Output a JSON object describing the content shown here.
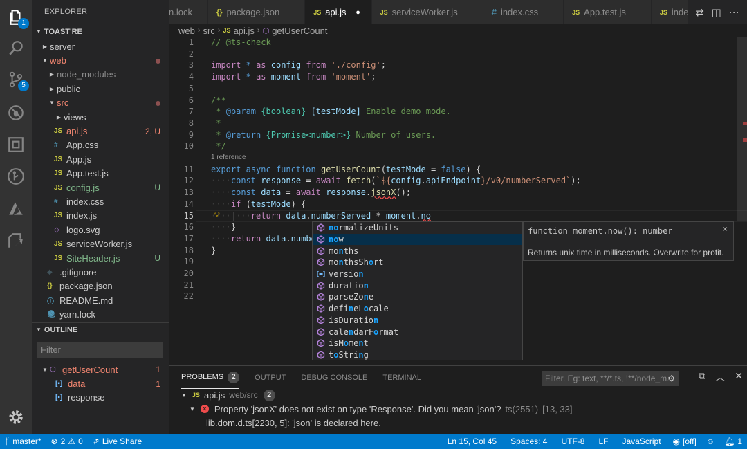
{
  "activity_bar": {
    "items": [
      {
        "name": "explorer",
        "badge": "1"
      },
      {
        "name": "search",
        "badge": null
      },
      {
        "name": "source-control",
        "badge": "5"
      },
      {
        "name": "debug",
        "badge": null
      },
      {
        "name": "extensions",
        "badge": null
      },
      {
        "name": "gitlens",
        "badge": null
      },
      {
        "name": "azure",
        "badge": null
      },
      {
        "name": "live-share",
        "badge": null
      }
    ]
  },
  "sidebar": {
    "title": "EXPLORER",
    "root": "TOAST'RE",
    "tree": [
      {
        "label": "server",
        "depth": 0,
        "type": "folder",
        "expanded": false,
        "color": "default",
        "deco": ""
      },
      {
        "label": "web",
        "depth": 0,
        "type": "folder",
        "expanded": true,
        "color": "red",
        "deco": "dot"
      },
      {
        "label": "node_modules",
        "depth": 1,
        "type": "folder",
        "expanded": false,
        "color": "dim",
        "deco": ""
      },
      {
        "label": "public",
        "depth": 1,
        "type": "folder",
        "expanded": false,
        "color": "default",
        "deco": ""
      },
      {
        "label": "src",
        "depth": 1,
        "type": "folder",
        "expanded": true,
        "color": "red",
        "deco": "dot"
      },
      {
        "label": "views",
        "depth": 2,
        "type": "folder",
        "expanded": false,
        "color": "default",
        "deco": ""
      },
      {
        "label": "api.js",
        "depth": 2,
        "type": "js",
        "color": "red",
        "deco": "2, U"
      },
      {
        "label": "App.css",
        "depth": 2,
        "type": "css",
        "color": "default",
        "deco": ""
      },
      {
        "label": "App.js",
        "depth": 2,
        "type": "js",
        "color": "default",
        "deco": ""
      },
      {
        "label": "App.test.js",
        "depth": 2,
        "type": "js",
        "color": "default",
        "deco": ""
      },
      {
        "label": "config.js",
        "depth": 2,
        "type": "js",
        "color": "green",
        "deco": "U"
      },
      {
        "label": "index.css",
        "depth": 2,
        "type": "css",
        "color": "default",
        "deco": ""
      },
      {
        "label": "index.js",
        "depth": 2,
        "type": "js",
        "color": "default",
        "deco": ""
      },
      {
        "label": "logo.svg",
        "depth": 2,
        "type": "svg",
        "color": "default",
        "deco": ""
      },
      {
        "label": "serviceWorker.js",
        "depth": 2,
        "type": "js",
        "color": "default",
        "deco": ""
      },
      {
        "label": "SiteHeader.js",
        "depth": 2,
        "type": "js",
        "color": "green",
        "deco": "U"
      },
      {
        "label": ".gitignore",
        "depth": 1,
        "type": "git",
        "color": "default",
        "deco": ""
      },
      {
        "label": "package.json",
        "depth": 1,
        "type": "json",
        "color": "default",
        "deco": ""
      },
      {
        "label": "README.md",
        "depth": 1,
        "type": "md",
        "color": "default",
        "deco": ""
      },
      {
        "label": "yarn.lock",
        "depth": 1,
        "type": "yarn",
        "color": "default",
        "deco": ""
      }
    ],
    "outline": {
      "title": "OUTLINE",
      "filter_placeholder": "Filter",
      "items": [
        {
          "label": "getUserCount",
          "depth": 0,
          "kind": "function",
          "color": "red",
          "count": "1"
        },
        {
          "label": "data",
          "depth": 1,
          "kind": "variable",
          "color": "red",
          "count": "1"
        },
        {
          "label": "response",
          "depth": 1,
          "kind": "variable",
          "color": "default",
          "count": ""
        }
      ]
    }
  },
  "tabs": [
    {
      "label": "n.lock",
      "icon": "",
      "active": false,
      "dirty": false
    },
    {
      "label": "package.json",
      "icon": "{}",
      "active": false,
      "dirty": false
    },
    {
      "label": "api.js",
      "icon": "JS",
      "active": true,
      "dirty": true
    },
    {
      "label": "serviceWorker.js",
      "icon": "JS",
      "active": false,
      "dirty": false
    },
    {
      "label": "index.css",
      "icon": "#",
      "active": false,
      "dirty": false
    },
    {
      "label": "App.test.js",
      "icon": "JS",
      "active": false,
      "dirty": false
    },
    {
      "label": "index.js",
      "icon": "JS",
      "active": false,
      "dirty": false
    }
  ],
  "breadcrumb": [
    "web",
    "src",
    "api.js",
    "getUserCount"
  ],
  "editor": {
    "codelens": "1 reference",
    "current_line": 15,
    "lines": [
      {
        "n": "1",
        "tokens": [
          [
            "c-com",
            "// @ts-check"
          ]
        ]
      },
      {
        "n": "2",
        "tokens": []
      },
      {
        "n": "3",
        "tokens": [
          [
            "c-ctl",
            "import"
          ],
          [
            "",
            " "
          ],
          [
            "c-kw",
            "*"
          ],
          [
            "",
            " "
          ],
          [
            "c-ctl",
            "as"
          ],
          [
            "",
            " "
          ],
          [
            "c-var",
            "config"
          ],
          [
            "",
            " "
          ],
          [
            "c-ctl",
            "from"
          ],
          [
            "",
            " "
          ],
          [
            "c-str",
            "'./config'"
          ],
          [
            "",
            ";"
          ]
        ]
      },
      {
        "n": "4",
        "tokens": [
          [
            "c-ctl",
            "import"
          ],
          [
            "",
            " "
          ],
          [
            "c-kw",
            "*"
          ],
          [
            "",
            " "
          ],
          [
            "c-ctl",
            "as"
          ],
          [
            "",
            " "
          ],
          [
            "c-var",
            "moment"
          ],
          [
            "",
            " "
          ],
          [
            "c-ctl",
            "from"
          ],
          [
            "",
            " "
          ],
          [
            "c-str",
            "'moment'"
          ],
          [
            "",
            ";"
          ]
        ]
      },
      {
        "n": "5",
        "tokens": []
      },
      {
        "n": "6",
        "tokens": [
          [
            "c-com",
            "/**"
          ]
        ]
      },
      {
        "n": "7",
        "tokens": [
          [
            "c-com",
            " * "
          ],
          [
            "c-tag",
            "@param"
          ],
          [
            "c-com",
            " "
          ],
          [
            "c-type",
            "{boolean}"
          ],
          [
            "c-com",
            " "
          ],
          [
            "c-var",
            "[testMode]"
          ],
          [
            "c-com",
            " Enable demo mode."
          ]
        ]
      },
      {
        "n": "8",
        "tokens": [
          [
            "c-com",
            " *"
          ]
        ]
      },
      {
        "n": "9",
        "tokens": [
          [
            "c-com",
            " * "
          ],
          [
            "c-tag",
            "@return"
          ],
          [
            "c-com",
            " "
          ],
          [
            "c-type",
            "{Promise<number>}"
          ],
          [
            "c-com",
            " Number of users."
          ]
        ]
      },
      {
        "n": "10",
        "tokens": [
          [
            "c-com",
            " */"
          ]
        ]
      },
      {
        "n": "11",
        "tokens": [
          [
            "c-kw",
            "export"
          ],
          [
            "",
            " "
          ],
          [
            "c-kw",
            "async"
          ],
          [
            "",
            " "
          ],
          [
            "c-kw",
            "function"
          ],
          [
            "",
            " "
          ],
          [
            "c-fn",
            "getUserCount"
          ],
          [
            "",
            "("
          ],
          [
            "c-var",
            "testMode"
          ],
          [
            "",
            " = "
          ],
          [
            "c-kw",
            "false"
          ],
          [
            "",
            ") {"
          ]
        ]
      },
      {
        "n": "12",
        "tokens": [
          [
            "ws",
            "····"
          ],
          [
            "c-kw",
            "const"
          ],
          [
            "",
            " "
          ],
          [
            "c-var",
            "response"
          ],
          [
            "",
            " = "
          ],
          [
            "c-ctl",
            "await"
          ],
          [
            "",
            " "
          ],
          [
            "c-fn",
            "fetch"
          ],
          [
            "",
            "("
          ],
          [
            "c-str",
            "`${"
          ],
          [
            "c-var",
            "config"
          ],
          [
            "",
            "."
          ],
          [
            "c-var",
            "apiEndpoint"
          ],
          [
            "c-str",
            "}/v0/numberServed`"
          ],
          [
            "",
            ");"
          ]
        ]
      },
      {
        "n": "13",
        "tokens": [
          [
            "ws",
            "····"
          ],
          [
            "c-kw",
            "const"
          ],
          [
            "",
            " "
          ],
          [
            "c-var",
            "data"
          ],
          [
            "",
            " = "
          ],
          [
            "c-ctl",
            "await"
          ],
          [
            "",
            " "
          ],
          [
            "c-var",
            "response"
          ],
          [
            "",
            "."
          ],
          [
            "c-fn squig",
            "jsonX"
          ],
          [
            "",
            "();"
          ]
        ]
      },
      {
        "n": "14",
        "tokens": [
          [
            "ws",
            "····"
          ],
          [
            "c-ctl",
            "if"
          ],
          [
            "",
            " ("
          ],
          [
            "c-var",
            "testMode"
          ],
          [
            "",
            ") {"
          ]
        ]
      },
      {
        "n": "15",
        "tokens": [
          [
            "ws",
            "····|···"
          ],
          [
            "c-ctl",
            "return"
          ],
          [
            "",
            " "
          ],
          [
            "c-var",
            "data"
          ],
          [
            "",
            "."
          ],
          [
            "c-var",
            "numberServed"
          ],
          [
            "",
            " * "
          ],
          [
            "c-var",
            "moment"
          ],
          [
            "",
            "."
          ],
          [
            "c-var squig",
            "no"
          ]
        ]
      },
      {
        "n": "16",
        "tokens": [
          [
            "ws",
            "····"
          ],
          [
            "",
            "}"
          ]
        ]
      },
      {
        "n": "17",
        "tokens": [
          [
            "ws",
            "····"
          ],
          [
            "c-ctl",
            "return"
          ],
          [
            "",
            " "
          ],
          [
            "c-var",
            "data"
          ],
          [
            "",
            "."
          ],
          [
            "c-var",
            "number"
          ]
        ]
      },
      {
        "n": "18",
        "tokens": [
          [
            "",
            "}"
          ]
        ]
      },
      {
        "n": "19",
        "tokens": []
      },
      {
        "n": "20",
        "tokens": []
      },
      {
        "n": "21",
        "tokens": []
      },
      {
        "n": "22",
        "tokens": []
      }
    ]
  },
  "suggest": {
    "items": [
      {
        "kind": "method",
        "parts": [
          [
            "",
            ""
          ],
          [
            "hl",
            "no"
          ],
          [
            "",
            "rmalizeUnits"
          ]
        ],
        "selected": false
      },
      {
        "kind": "method",
        "parts": [
          [
            "hl",
            "no"
          ],
          [
            "",
            "w"
          ]
        ],
        "selected": true
      },
      {
        "kind": "method",
        "parts": [
          [
            "",
            "mo"
          ],
          [
            "hl",
            "n"
          ],
          [
            "",
            "ths"
          ]
        ],
        "selected": false
      },
      {
        "kind": "method",
        "parts": [
          [
            "",
            "mo"
          ],
          [
            "hl",
            "n"
          ],
          [
            "",
            "thsSh"
          ],
          [
            "hl",
            "o"
          ],
          [
            "",
            "rt"
          ]
        ],
        "selected": false
      },
      {
        "kind": "variable",
        "parts": [
          [
            "",
            "versio"
          ],
          [
            "hl",
            "n"
          ]
        ],
        "selected": false
      },
      {
        "kind": "method",
        "parts": [
          [
            "",
            "duratio"
          ],
          [
            "hl",
            "n"
          ]
        ],
        "selected": false
      },
      {
        "kind": "method",
        "parts": [
          [
            "",
            "parseZo"
          ],
          [
            "hl",
            "n"
          ],
          [
            "",
            "e"
          ]
        ],
        "selected": false
      },
      {
        "kind": "method",
        "parts": [
          [
            "",
            "defi"
          ],
          [
            "hl",
            "n"
          ],
          [
            "",
            "eL"
          ],
          [
            "hl",
            "o"
          ],
          [
            "",
            "cale"
          ]
        ],
        "selected": false
      },
      {
        "kind": "method",
        "parts": [
          [
            "",
            "isDuratio"
          ],
          [
            "hl",
            "n"
          ]
        ],
        "selected": false
      },
      {
        "kind": "method",
        "parts": [
          [
            "",
            "cale"
          ],
          [
            "hl",
            "n"
          ],
          [
            "",
            "darF"
          ],
          [
            "hl",
            "o"
          ],
          [
            "",
            "rmat"
          ]
        ],
        "selected": false
      },
      {
        "kind": "method",
        "parts": [
          [
            "",
            "isM"
          ],
          [
            "hl",
            "o"
          ],
          [
            "",
            "me"
          ],
          [
            "hl",
            "n"
          ],
          [
            "",
            "t"
          ]
        ],
        "selected": false
      },
      {
        "kind": "method",
        "parts": [
          [
            "",
            "t"
          ],
          [
            "hl",
            "o"
          ],
          [
            "",
            "Stri"
          ],
          [
            "hl",
            "n"
          ],
          [
            "",
            "g"
          ]
        ],
        "selected": false
      }
    ],
    "details": {
      "signature": "function moment.now(): number",
      "doc": "Returns unix time in milliseconds. Overwrite for profit.",
      "close": "×"
    }
  },
  "panel": {
    "tabs": [
      {
        "label": "PROBLEMS",
        "count": "2",
        "active": true
      },
      {
        "label": "OUTPUT",
        "count": null,
        "active": false
      },
      {
        "label": "DEBUG CONSOLE",
        "count": null,
        "active": false
      },
      {
        "label": "TERMINAL",
        "count": null,
        "active": false
      }
    ],
    "filter_placeholder": "Filter. Eg: text, **/*.ts, !**/node_m...",
    "file": {
      "name": "api.js",
      "path": "web/src",
      "count": "2"
    },
    "problem": {
      "message": "Property 'jsonX' does not exist on type 'Response'. Did you mean 'json'?",
      "code": "ts(2551)",
      "location": "[13, 33]",
      "related": "lib.dom.d.ts[2230, 5]: 'json' is declared here."
    }
  },
  "statusbar": {
    "branch": "master*",
    "errors": "2",
    "warnings": "0",
    "live_share": "Live Share",
    "position": "Ln 15, Col 45",
    "spaces": "Spaces: 4",
    "encoding": "UTF-8",
    "eol": "LF",
    "language": "JavaScript",
    "eye": "[off]"
  },
  "colors": {
    "accent": "#007acc",
    "error": "#f14c4c",
    "modified_red": "#f48771",
    "untracked_green": "#81b88b"
  }
}
